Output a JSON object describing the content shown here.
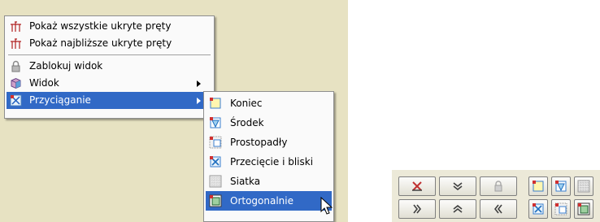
{
  "context_menu": {
    "items": [
      {
        "label": "Pokaż wszystkie ukryte pręty",
        "icon": "hidden-bars-icon"
      },
      {
        "label": "Pokaż najbliższe ukryte pręty",
        "icon": "hidden-bars-icon"
      },
      {
        "label": "Zablokuj widok",
        "icon": "lock-icon"
      },
      {
        "label": "Widok",
        "icon": "view-cube-icon",
        "has_submenu": true
      },
      {
        "label": "Przyciąganie",
        "icon": "snap-icon",
        "has_submenu": true,
        "selected": true
      }
    ]
  },
  "snap_submenu": {
    "items": [
      {
        "label": "Koniec",
        "icon": "snap-end-icon"
      },
      {
        "label": "Środek",
        "icon": "snap-middle-icon"
      },
      {
        "label": "Prostopadły",
        "icon": "snap-perpendicular-icon"
      },
      {
        "label": "Przecięcie i bliski",
        "icon": "snap-intersection-icon"
      },
      {
        "label": "Siatka",
        "icon": "snap-grid-icon"
      },
      {
        "label": "Ortogonalnie",
        "icon": "snap-orthogonal-icon",
        "selected": true
      }
    ]
  },
  "toolbar": {
    "buttons": [
      {
        "icon": "clear-x-icon"
      },
      {
        "icon": "chevron-down-icon"
      },
      {
        "icon": "lock-icon",
        "disabled": true
      },
      {
        "icon": "chevron-right-icon"
      },
      {
        "icon": "chevron-up-icon"
      },
      {
        "icon": "chevron-left-icon"
      },
      {
        "icon": "snap-end-icon"
      },
      {
        "icon": "snap-middle-icon"
      },
      {
        "icon": "snap-grid-icon"
      },
      {
        "icon": "snap-intersection-icon"
      },
      {
        "icon": "snap-perpendicular-icon"
      },
      {
        "icon": "snap-orthogonal-icon"
      }
    ]
  },
  "colors": {
    "canvas": "#e7e2c2",
    "highlight": "#3169c6",
    "menu_bg": "#fafafa",
    "toolbar_bg": "#ece9d8"
  }
}
